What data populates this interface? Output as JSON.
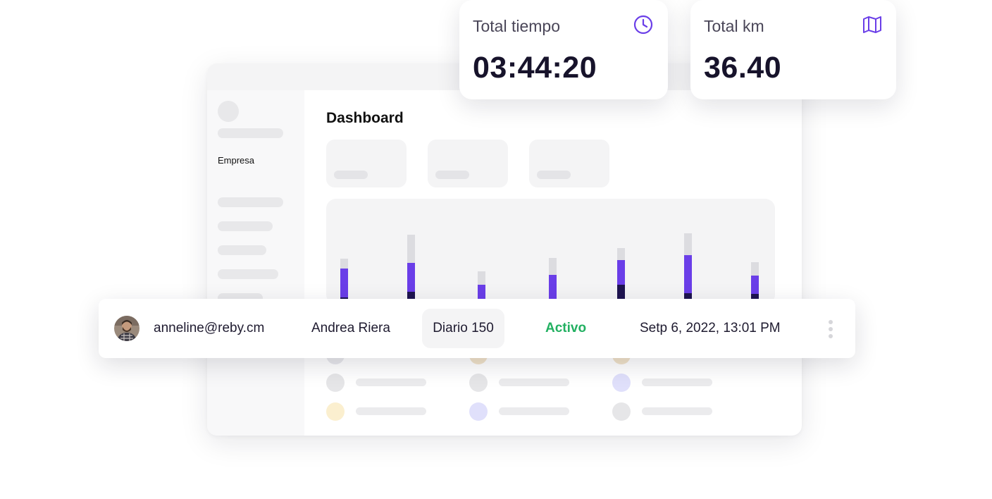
{
  "dashboard": {
    "title": "Dashboard",
    "sidebar": {
      "active_item": "Empresa"
    }
  },
  "metrics": [
    {
      "label": "Total tiempo",
      "value": "03:44:20",
      "icon": "clock-icon"
    },
    {
      "label": "Total km",
      "value": "36.40",
      "icon": "map-icon"
    }
  ],
  "colors": {
    "accent": "#6a3ee8",
    "dark": "#1e1450",
    "muted": "#dcdce0",
    "status_active": "#22b061"
  },
  "user_row": {
    "email": "anneline@reby.cm",
    "name": "Andrea Riera",
    "plan": "Diario 150",
    "status": "Activo",
    "datetime": "Setp 6, 2022, 13:01 PM",
    "avatar_icon": "avatar",
    "menu_icon": "kebab-menu-icon"
  },
  "chart_data": {
    "type": "bar",
    "stacked": true,
    "categories": [
      "",
      "",
      "",
      "",
      "",
      "",
      ""
    ],
    "series": [
      {
        "values": [
          30,
          38,
          21,
          25,
          48,
          36,
          35
        ]
      },
      {
        "values": [
          41,
          41,
          27,
          37,
          35,
          54,
          26
        ]
      },
      {
        "values": [
          14,
          40,
          19,
          24,
          17,
          31,
          19
        ]
      }
    ],
    "ylim": [
      0,
      120
    ],
    "grid": false
  }
}
